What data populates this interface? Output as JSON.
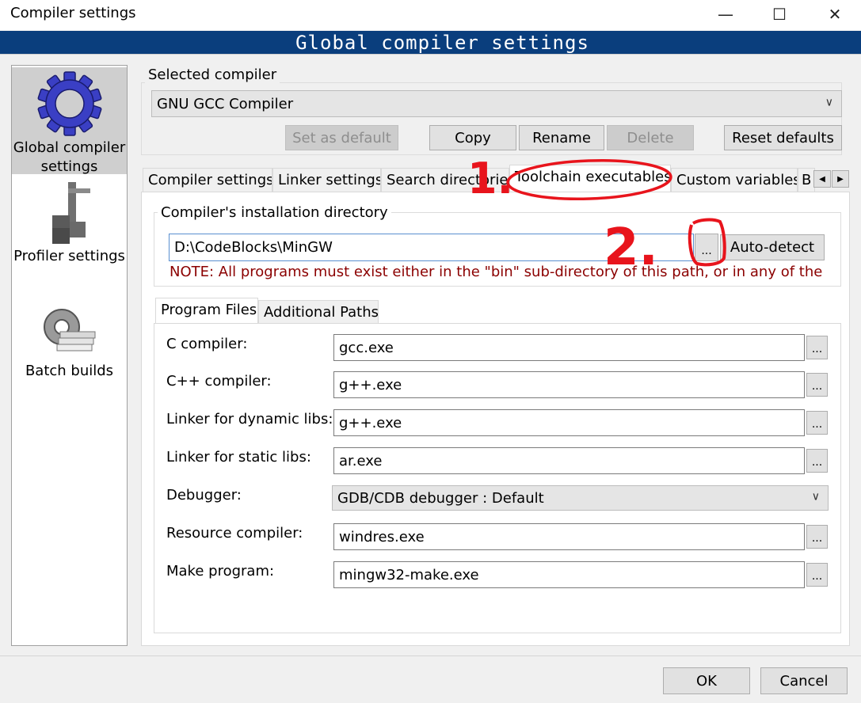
{
  "window": {
    "title": "Compiler settings",
    "minimize_glyph": "—",
    "maximize_glyph": "☐",
    "close_glyph": "✕"
  },
  "banner": {
    "title": "Global compiler settings"
  },
  "sidebar": {
    "items": [
      {
        "label": "Global compiler settings",
        "icon": "gear-icon",
        "selected": true
      },
      {
        "label": "Profiler settings",
        "icon": "caliper-icon",
        "selected": false
      },
      {
        "label": "Batch builds",
        "icon": "batch-gear-icon",
        "selected": false
      }
    ]
  },
  "selected_compiler": {
    "group_label": "Selected compiler",
    "value": "GNU GCC Compiler",
    "buttons": {
      "set_default": "Set as default",
      "copy": "Copy",
      "rename": "Rename",
      "delete": "Delete",
      "reset": "Reset defaults"
    }
  },
  "tabs": [
    {
      "label": "Compiler settings",
      "selected": false
    },
    {
      "label": "Linker settings",
      "selected": false
    },
    {
      "label": "Search directories",
      "selected": false
    },
    {
      "label": "Toolchain executables",
      "selected": true
    },
    {
      "label": "Custom variables",
      "selected": false
    },
    {
      "label": "B",
      "selected": false
    }
  ],
  "tab_scroll": {
    "left": "◀",
    "right": "▶"
  },
  "install_dir": {
    "group_label": "Compiler's installation directory",
    "value": "D:\\CodeBlocks\\MinGW",
    "browse_label": "...",
    "autodetect_label": "Auto-detect",
    "note": "NOTE: All programs must exist either in the \"bin\" sub-directory of this path, or in any of the"
  },
  "subtabs": [
    {
      "label": "Program Files",
      "selected": true
    },
    {
      "label": "Additional Paths",
      "selected": false
    }
  ],
  "program_files": [
    {
      "label": "C compiler:",
      "value": "gcc.exe",
      "kind": "text"
    },
    {
      "label": "C++ compiler:",
      "value": "g++.exe",
      "kind": "text"
    },
    {
      "label": "Linker for dynamic libs:",
      "value": "g++.exe",
      "kind": "text"
    },
    {
      "label": "Linker for static libs:",
      "value": "ar.exe",
      "kind": "text"
    },
    {
      "label": "Debugger:",
      "value": "GDB/CDB debugger : Default",
      "kind": "combo"
    },
    {
      "label": "Resource compiler:",
      "value": "windres.exe",
      "kind": "text"
    },
    {
      "label": "Make program:",
      "value": "mingw32-make.exe",
      "kind": "text"
    }
  ],
  "browse_label": "...",
  "footer": {
    "ok": "OK",
    "cancel": "Cancel"
  },
  "annotations": {
    "step1": "1.",
    "step2": "2.",
    "color": "#e8141c"
  },
  "colors": {
    "banner": "#0a3e7d",
    "note": "#8b0000",
    "selection": "#cfcfcf"
  }
}
